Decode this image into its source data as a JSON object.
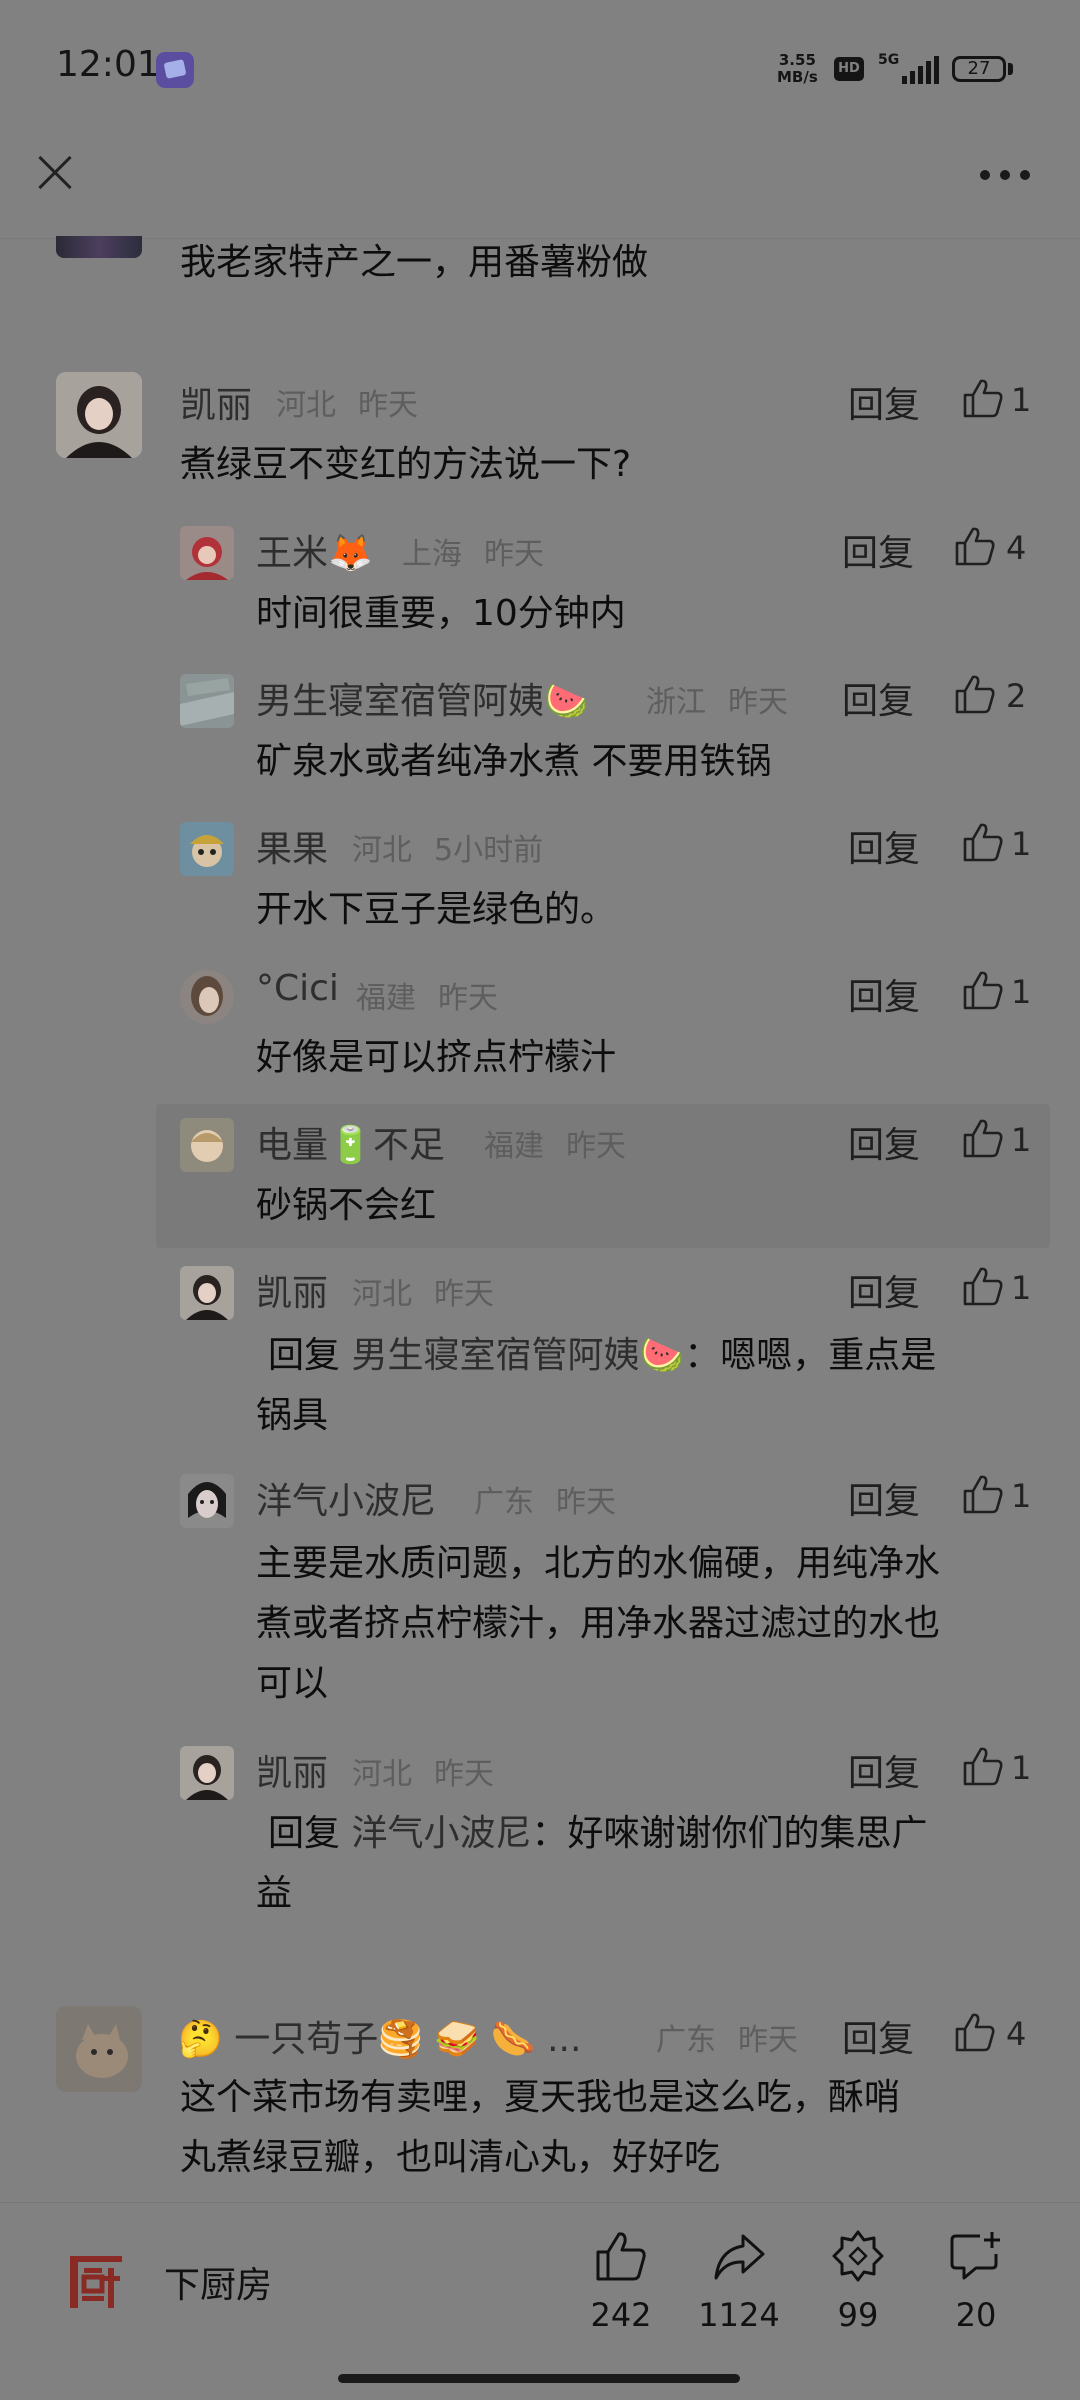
{
  "status_bar": {
    "time": "12:01",
    "net_speed_value": "3.55",
    "net_speed_unit": "MB/s",
    "hd": "HD",
    "network": "5G",
    "battery": "27"
  },
  "top_comment_tail": {
    "text": "我老家特产之一，用番薯粉做"
  },
  "thread": {
    "main": {
      "name": "凯丽",
      "location": "河北",
      "time": "昨天",
      "reply_label": "回复",
      "likes": "1",
      "text": "煮绿豆不变红的方法说一下?"
    },
    "replies": [
      {
        "name": "王米🦊",
        "location": "上海",
        "time": "昨天",
        "reply_label": "回复",
        "likes": "4",
        "text": "时间很重要，10分钟内"
      },
      {
        "name": "男生寝室宿管阿姨🍉",
        "location": "浙江",
        "time": "昨天",
        "reply_label": "回复",
        "likes": "2",
        "text": "矿泉水或者纯净水煮 不要用铁锅"
      },
      {
        "name": "果果",
        "location": "河北",
        "time": "5小时前",
        "reply_label": "回复",
        "likes": "1",
        "text": "开水下豆子是绿色的。"
      },
      {
        "name": "°Cici",
        "location": "福建",
        "time": "昨天",
        "reply_label": "回复",
        "likes": "1",
        "text": "好像是可以挤点柠檬汁"
      },
      {
        "name": "电量🔋不足",
        "location": "福建",
        "time": "昨天",
        "reply_label": "回复",
        "likes": "1",
        "text": "砂锅不会红"
      },
      {
        "name": "凯丽",
        "location": "河北",
        "time": "昨天",
        "reply_label": "回复",
        "likes": "1",
        "reply_prefix": "回复",
        "reply_to": "男生寝室宿管阿姨🍉",
        "text_line1": "：嗯嗯，重点是",
        "text_line2": "锅具"
      },
      {
        "name": "洋气小波尼",
        "location": "广东",
        "time": "昨天",
        "reply_label": "回复",
        "likes": "1",
        "text_line1": "主要是水质问题，北方的水偏硬，用纯净水",
        "text_line2": "煮或者挤点柠檬汁，用净水器过滤过的水也",
        "text_line3": "可以"
      },
      {
        "name": "凯丽",
        "location": "河北",
        "time": "昨天",
        "reply_label": "回复",
        "likes": "1",
        "reply_prefix": "回复",
        "reply_to": "洋气小波尼",
        "text_line1": "：好唻谢谢你们的集思广",
        "text_line2": "益"
      }
    ]
  },
  "next_comment": {
    "name": "🤔 一只苟子🥞 🥪 🌭 ...",
    "location": "广东",
    "time": "昨天",
    "reply_label": "回复",
    "likes": "4",
    "text_line1": "这个菜市场有卖哩，夏天我也是这么吃，酥哨",
    "text_line2": "丸煮绿豆瓣，也叫清心丸，好好吃"
  },
  "bottom_bar": {
    "brand_name": "下厨房",
    "like_count": "242",
    "share_count": "1124",
    "collect_count": "99",
    "comment_count": "20"
  },
  "colors": {
    "background": "#818181",
    "brand_red": "#8a2a24"
  }
}
